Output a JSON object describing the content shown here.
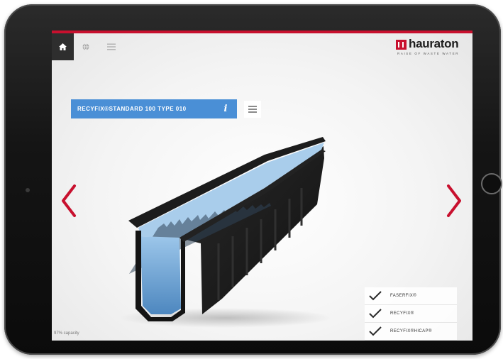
{
  "header": {
    "logo_text": "hauraton",
    "logo_tagline": "RAISE OF WASTE WATER",
    "icons": [
      "home-icon",
      "globe-icon",
      "menu-icon"
    ]
  },
  "product": {
    "label": "RECYFIX®STANDARD 100 TYPE 010",
    "info_symbol": "i"
  },
  "navigation": {
    "previous_icon": "chevron-left-icon",
    "next_icon": "chevron-right-icon"
  },
  "status": {
    "capacity_text": "97% capacity"
  },
  "options": [
    {
      "label": "FASERFIX®",
      "checked": true
    },
    {
      "label": "RECYFIX®",
      "checked": true
    },
    {
      "label": "RECYFIX®HICAP®",
      "checked": true
    }
  ],
  "colors": {
    "accent_red": "#c8102e",
    "product_blue": "#4a8fd6",
    "water_blue": "#6fa6d6",
    "channel_black": "#1a1a1a"
  }
}
